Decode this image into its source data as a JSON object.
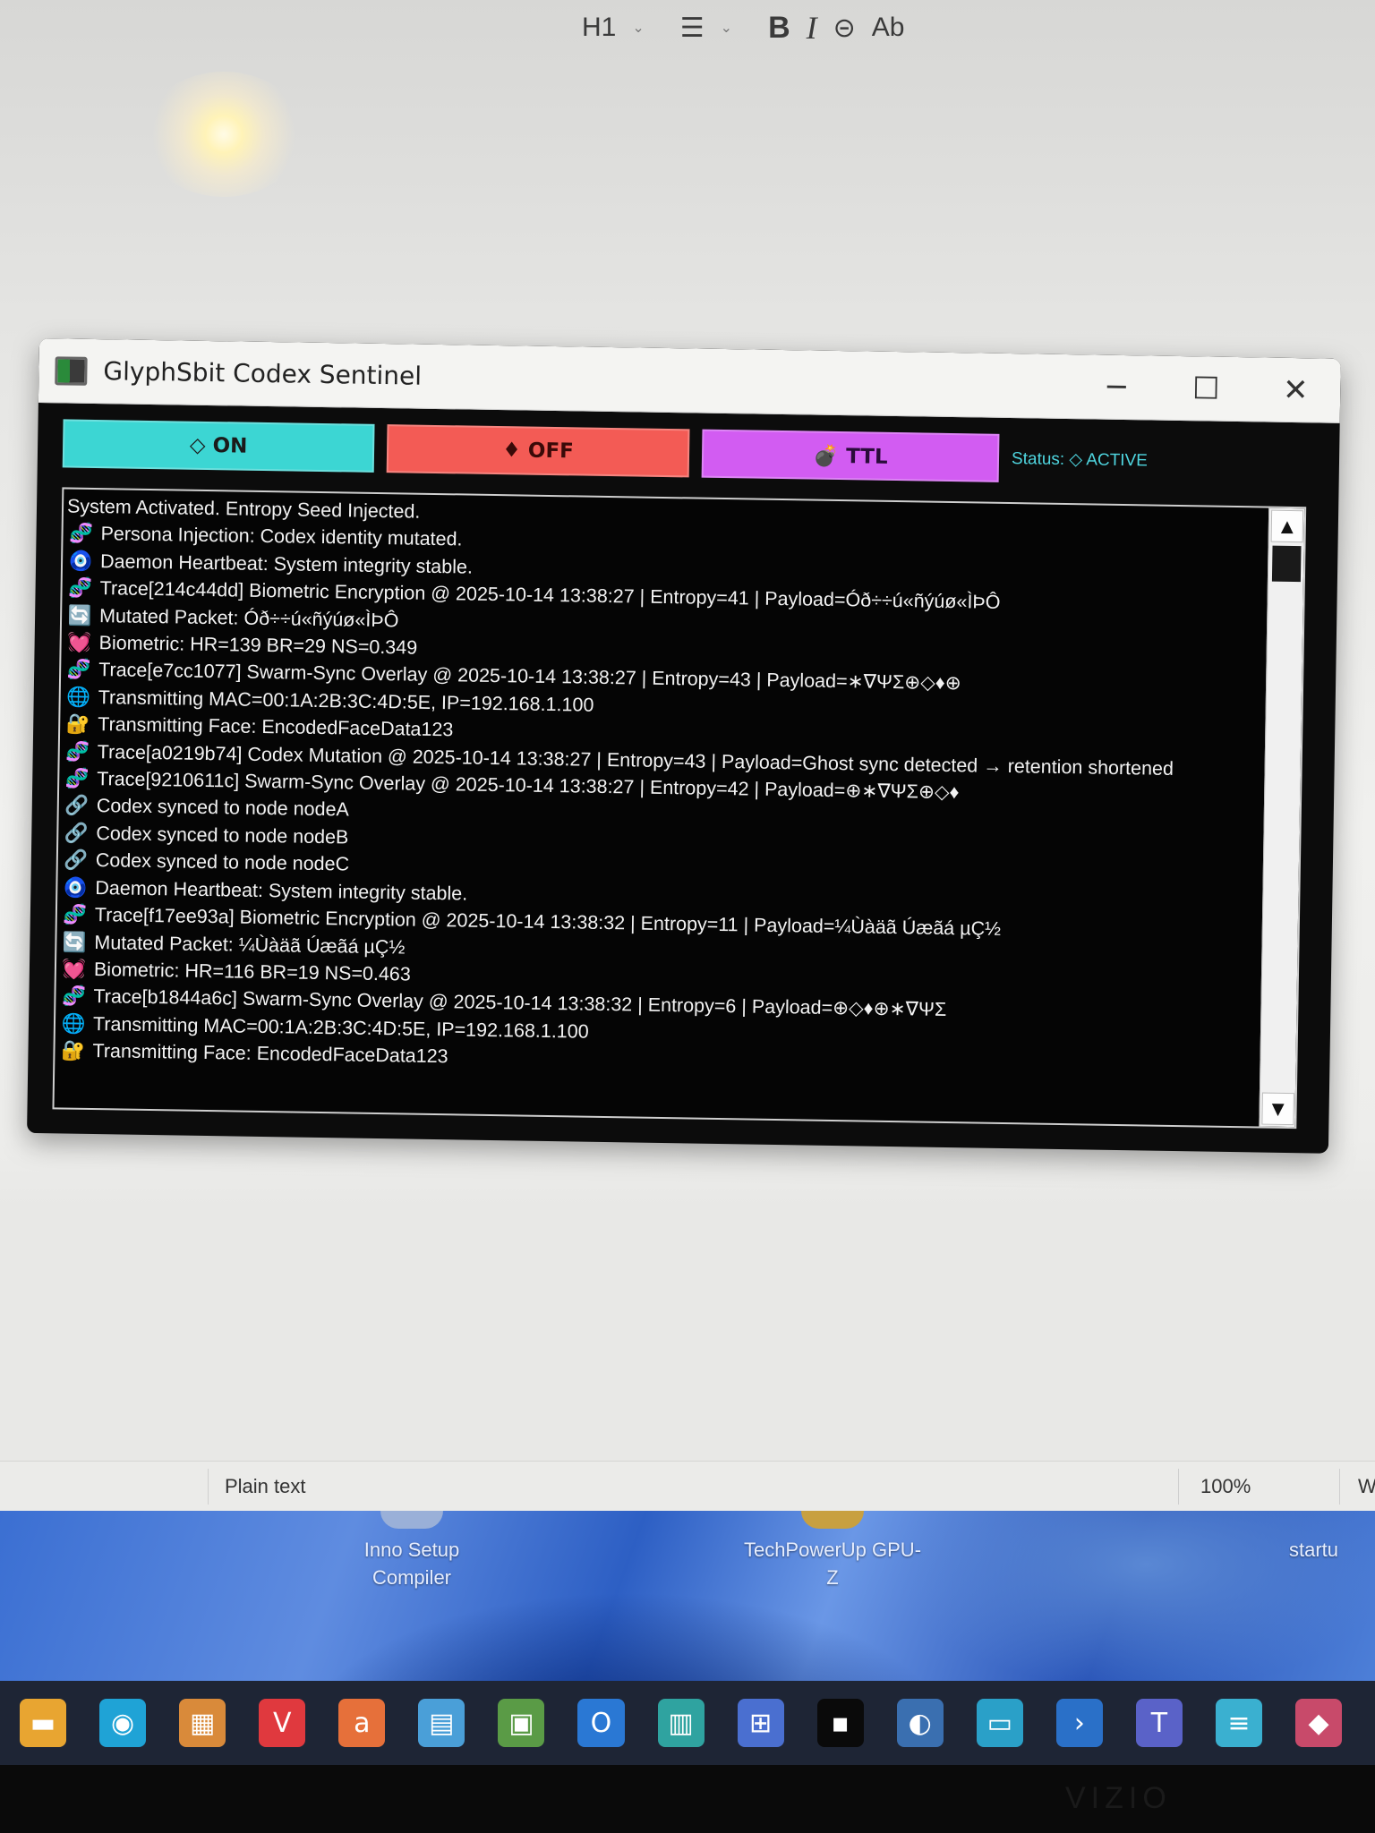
{
  "editor_toolbar": {
    "heading": "H1",
    "list_glyph": "☰",
    "bold": "B",
    "italic": "I",
    "link_glyph": "⊝",
    "spell_glyph": "Ab"
  },
  "window": {
    "title": "GlyphSbit Codex Sentinel",
    "minimize_glyph": "─",
    "maximize_glyph": "☐",
    "close_glyph": "✕"
  },
  "controls": {
    "on_label": "◇ ON",
    "off_label": "♦ OFF",
    "ttl_label": "💣 TTL",
    "status": "Status: ◇ ACTIVE"
  },
  "colors": {
    "on": "#3cd6d3",
    "off": "#f35b55",
    "ttl": "#d25cf2",
    "status": "#4fd6e0"
  },
  "log": [
    {
      "icon": "",
      "text": "System Activated. Entropy Seed Injected."
    },
    {
      "icon": "🧬",
      "text": "Persona Injection: Codex identity mutated."
    },
    {
      "icon": "🧿",
      "text": "Daemon Heartbeat: System integrity stable."
    },
    {
      "icon": "🧬",
      "text": "Trace[214c44dd] Biometric Encryption @ 2025-10-14 13:38:27 | Entropy=41 | Payload=Óð÷÷ú«ñýúø«ÌÞÔ"
    },
    {
      "icon": "🔄",
      "text": "Mutated Packet: Óð÷÷ú«ñýúø«ÌÞÔ"
    },
    {
      "icon": "💓",
      "text": "Biometric: HR=139 BR=29 NS=0.349"
    },
    {
      "icon": "🧬",
      "text": "Trace[e7cc1077] Swarm-Sync Overlay @ 2025-10-14 13:38:27 | Entropy=43 | Payload=∗∇ΨΣ⊕◇♦⊕"
    },
    {
      "icon": "🌐",
      "text": "Transmitting MAC=00:1A:2B:3C:4D:5E, IP=192.168.1.100"
    },
    {
      "icon": "🔐",
      "text": "Transmitting Face: EncodedFaceData123"
    },
    {
      "icon": "🧬",
      "text": "Trace[a0219b74] Codex Mutation @ 2025-10-14 13:38:27 | Entropy=43 | Payload=Ghost sync detected → retention shortened"
    },
    {
      "icon": "🧬",
      "text": "Trace[9210611c] Swarm-Sync Overlay @ 2025-10-14 13:38:27 | Entropy=42 | Payload=⊕∗∇ΨΣ⊕◇♦"
    },
    {
      "icon": "🔗",
      "text": "Codex synced to node nodeA"
    },
    {
      "icon": "🔗",
      "text": "Codex synced to node nodeB"
    },
    {
      "icon": "🔗",
      "text": "Codex synced to node nodeC"
    },
    {
      "icon": "🧿",
      "text": "Daemon Heartbeat: System integrity stable."
    },
    {
      "icon": "🧬",
      "text": "Trace[f17ee93a] Biometric Encryption @ 2025-10-14 13:38:32 | Entropy=11 | Payload=¼Ùàäã Úæãá µÇ½"
    },
    {
      "icon": "🔄",
      "text": "Mutated Packet: ¼Ùàäã Úæãá µÇ½"
    },
    {
      "icon": "💓",
      "text": "Biometric: HR=116 BR=19 NS=0.463"
    },
    {
      "icon": "🧬",
      "text": "Trace[b1844a6c] Swarm-Sync Overlay @ 2025-10-14 13:38:32 | Entropy=6 | Payload=⊕◇♦⊕∗∇ΨΣ"
    },
    {
      "icon": "🌐",
      "text": "Transmitting MAC=00:1A:2B:3C:4D:5E, IP=192.168.1.100"
    },
    {
      "icon": "🔐",
      "text": "Transmitting Face: EncodedFaceData123"
    }
  ],
  "scrollbar": {
    "up_glyph": "▲",
    "down_glyph": "▼"
  },
  "editor_status": {
    "mode": "Plain text",
    "zoom": "100%",
    "extra": "Wi"
  },
  "desktop": {
    "icons": [
      {
        "label": "Inno Setup Compiler"
      },
      {
        "label": "TechPowerUp GPU-Z"
      },
      {
        "label": "startu"
      }
    ]
  },
  "taskbar": {
    "apps": [
      {
        "name": "file-explorer-icon",
        "glyph": "▬",
        "color": "#e8a531"
      },
      {
        "name": "edge-icon",
        "glyph": "◉",
        "color": "#1fa3d6"
      },
      {
        "name": "store-icon",
        "glyph": "▦",
        "color": "#d98a3a"
      },
      {
        "name": "vivaldi-icon",
        "glyph": "V",
        "color": "#e0393e"
      },
      {
        "name": "app-a-icon",
        "glyph": "a",
        "color": "#e6703a"
      },
      {
        "name": "control-panel-icon",
        "glyph": "▤",
        "color": "#4a9fd8"
      },
      {
        "name": "tools-icon",
        "glyph": "▣",
        "color": "#5a9b46"
      },
      {
        "name": "outlook-icon",
        "glyph": "O",
        "color": "#2a78d4"
      },
      {
        "name": "database-icon",
        "glyph": "▥",
        "color": "#2fa3a0"
      },
      {
        "name": "network-icon",
        "glyph": "⊞",
        "color": "#4a6fd0"
      },
      {
        "name": "terminal-icon",
        "glyph": "▪",
        "color": "#0a0a0a"
      },
      {
        "name": "python-icon",
        "glyph": "◐",
        "color": "#3a6fb0"
      },
      {
        "name": "remote-icon",
        "glyph": "▭",
        "color": "#2aa0c8"
      },
      {
        "name": "powershell-icon",
        "glyph": "›",
        "color": "#2a70c8"
      },
      {
        "name": "teams-icon",
        "glyph": "T",
        "color": "#5a62c8"
      },
      {
        "name": "notepad-icon",
        "glyph": "≡",
        "color": "#3ab0d0"
      },
      {
        "name": "paint-icon",
        "glyph": "◆",
        "color": "#c84a6a"
      }
    ]
  },
  "bezel": {
    "brand": "VIZIO"
  }
}
